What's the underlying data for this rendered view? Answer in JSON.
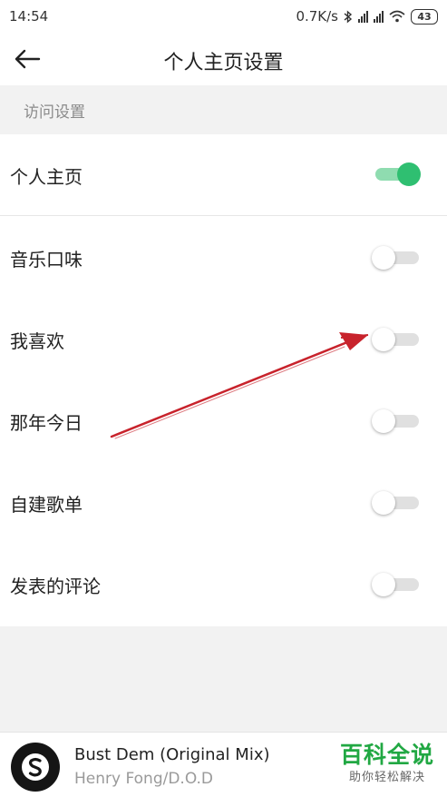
{
  "status_bar": {
    "time": "14:54",
    "net_speed": "0.7K/s",
    "battery": "43",
    "icons": [
      "bluetooth-icon",
      "signal-icon",
      "signal-icon",
      "wifi-icon",
      "battery-icon"
    ]
  },
  "header": {
    "back_icon": "arrow-left-icon",
    "title": "个人主页设置"
  },
  "section": {
    "title": "访问设置"
  },
  "settings": [
    {
      "label": "个人主页",
      "enabled": true
    },
    {
      "label": "音乐口味",
      "enabled": false
    },
    {
      "label": "我喜欢",
      "enabled": false
    },
    {
      "label": "那年今日",
      "enabled": false
    },
    {
      "label": "自建歌单",
      "enabled": false
    },
    {
      "label": "发表的评论",
      "enabled": false
    }
  ],
  "colors": {
    "toggle_on": "#2fbf71",
    "toggle_on_track": "#8fdcb0",
    "toggle_off_track": "#e0e0e0",
    "annotation_arrow": "#c8232c",
    "watermark": "#21a843"
  },
  "player": {
    "title": "Bust Dem (Original Mix)",
    "artist": "Henry Fong/D.O.D"
  },
  "watermark": {
    "main": "百科全说",
    "sub": "助你轻松解决"
  }
}
